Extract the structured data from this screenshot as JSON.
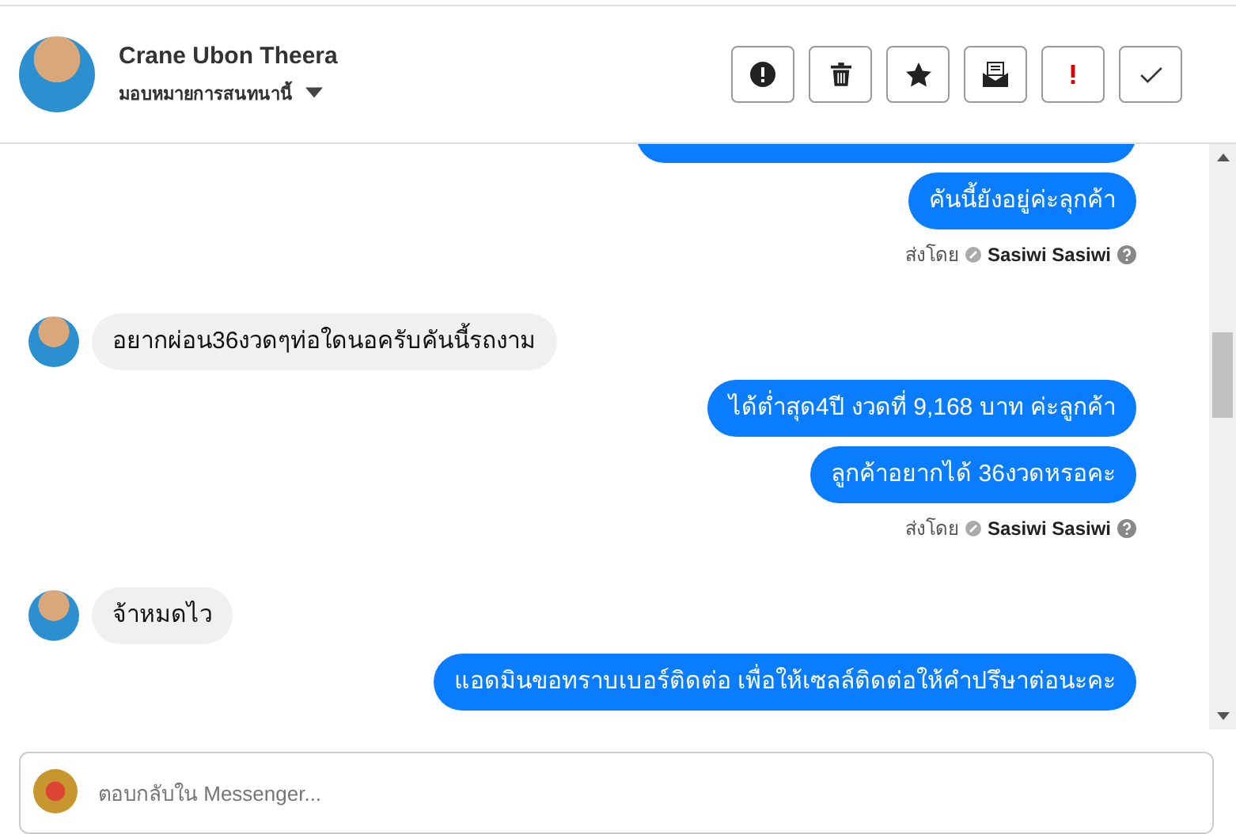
{
  "header": {
    "name": "Crane Ubon Theera",
    "assign_label": "มอบหมายการสนทนานี้",
    "actions": [
      {
        "kind": "alert"
      },
      {
        "kind": "trash"
      },
      {
        "kind": "star"
      },
      {
        "kind": "mail"
      },
      {
        "kind": "exclaim"
      },
      {
        "kind": "check"
      }
    ]
  },
  "messages": [
    {
      "kind": "out",
      "text": "คันนี้ยังอยู่ค่ะลุกค้า"
    },
    {
      "kind": "note",
      "prefix": "ส่งโดย",
      "sender": "Sasiwi Sasiwi"
    },
    {
      "kind": "in",
      "text": "อยากผ่อน36งวดๆท่อใดนอครับคันนี้รถงาม"
    },
    {
      "kind": "out",
      "text": "ได้ต่ำสุด4ปี งวดที่ 9,168 บาท ค่ะลูกค้า"
    },
    {
      "kind": "out",
      "text": "ลูกค้าอยากได้ 36งวดหรอคะ"
    },
    {
      "kind": "note",
      "prefix": "ส่งโดย",
      "sender": "Sasiwi Sasiwi"
    },
    {
      "kind": "in",
      "text": "จ้าหมดไว"
    },
    {
      "kind": "out",
      "text": "แอดมินขอทราบเบอร์ติดต่อ เพื่อให้เซลล์ติดต่อให้คำปรึษาต่อนะคะ"
    }
  ],
  "composer": {
    "placeholder": "ตอบกลับใน Messenger..."
  }
}
